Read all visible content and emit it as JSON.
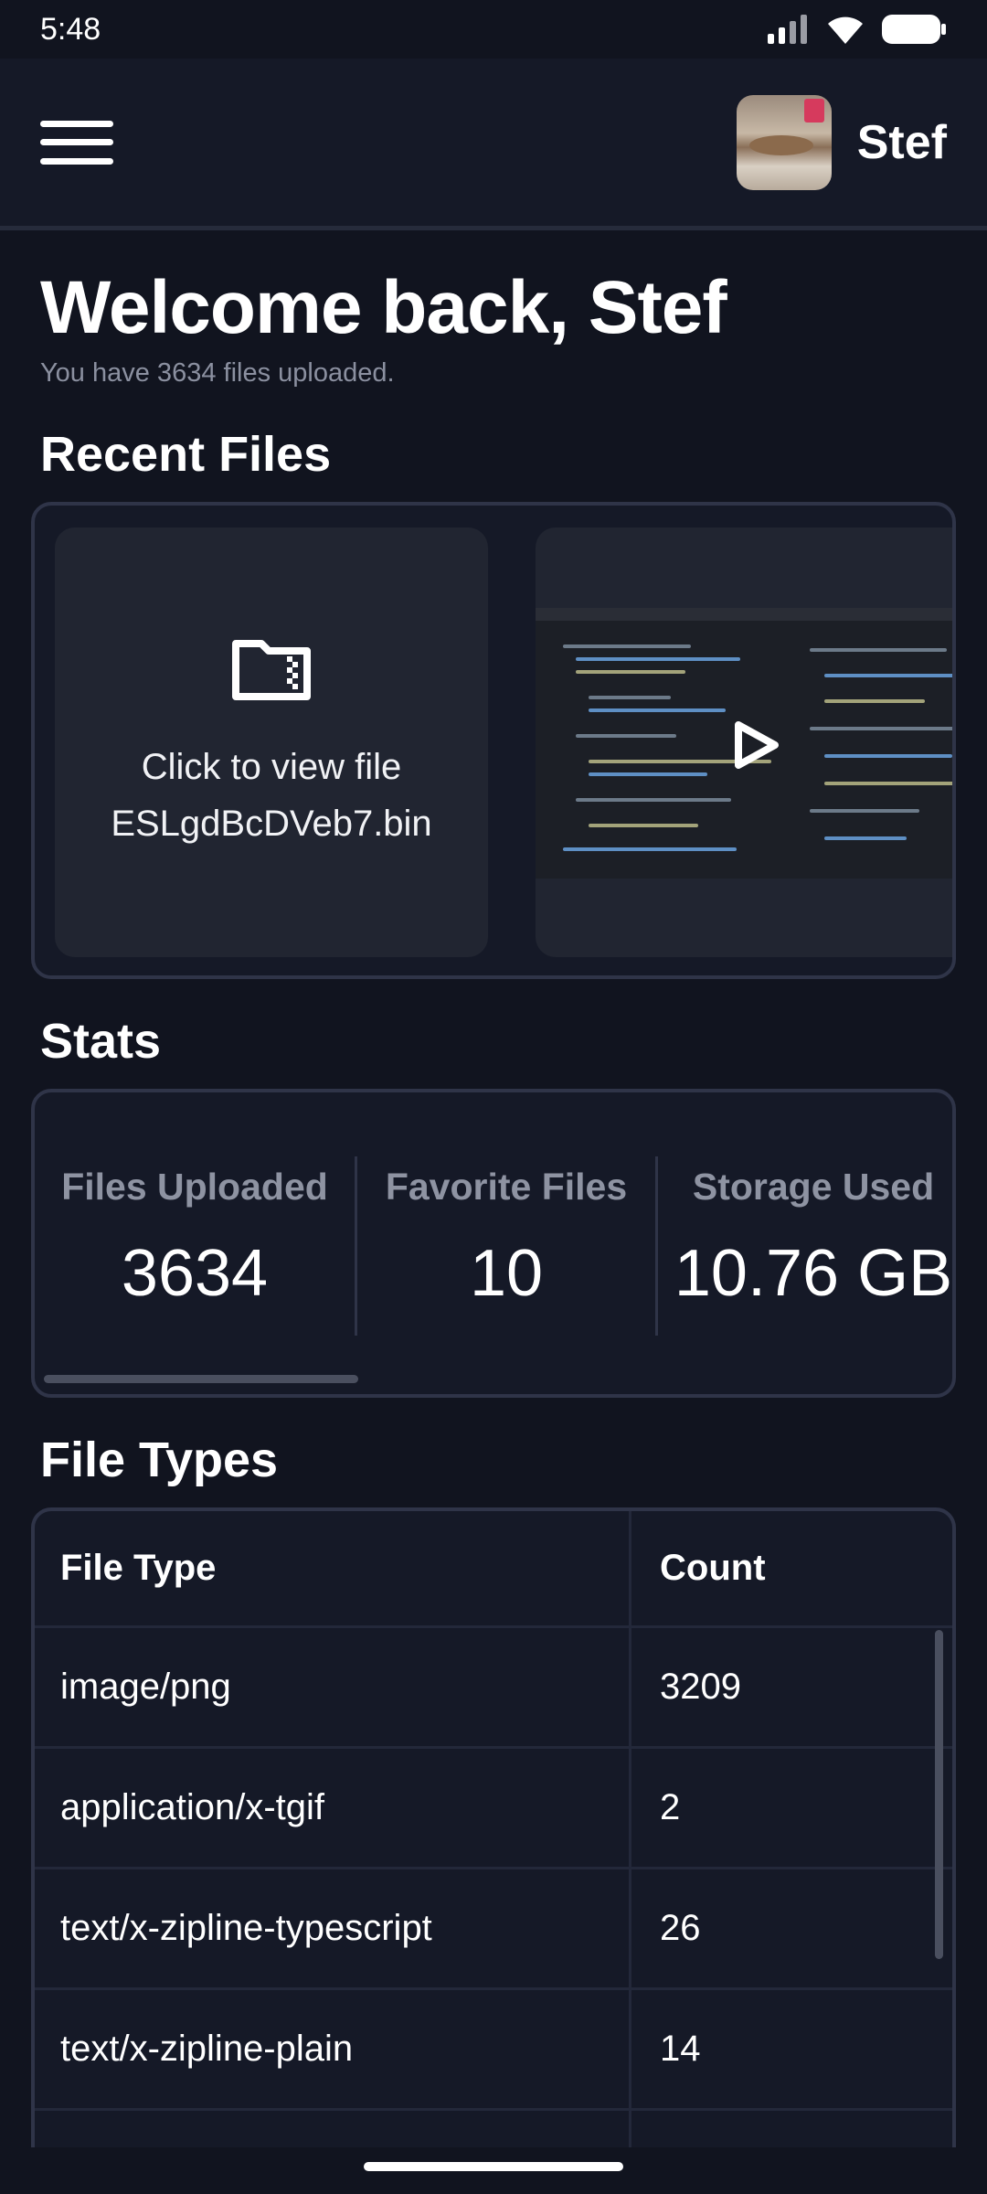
{
  "status_bar": {
    "time": "5:48"
  },
  "header": {
    "user_name": "Stef"
  },
  "welcome": {
    "title": "Welcome back, Stef",
    "subtitle": "You have 3634 files uploaded."
  },
  "recent_files": {
    "title": "Recent Files",
    "cards": [
      {
        "line1": "Click to view file",
        "line2": "ESLgdBcDVeb7.bin"
      }
    ]
  },
  "stats": {
    "title": "Stats",
    "items": [
      {
        "label": "Files Uploaded",
        "value": "3634"
      },
      {
        "label": "Favorite Files",
        "value": "10"
      },
      {
        "label": "Storage Used",
        "value": "10.76 GB"
      }
    ]
  },
  "file_types": {
    "title": "File Types",
    "headers": {
      "type": "File Type",
      "count": "Count"
    },
    "rows": [
      {
        "type": "image/png",
        "count": "3209"
      },
      {
        "type": "application/x-tgif",
        "count": "2"
      },
      {
        "type": "text/x-zipline-typescript",
        "count": "26"
      },
      {
        "type": "text/x-zipline-plain",
        "count": "14"
      }
    ]
  },
  "colors": {
    "background": "#11141f",
    "card": "#212531",
    "border": "#2f3448",
    "muted_text": "#8e93a2"
  }
}
